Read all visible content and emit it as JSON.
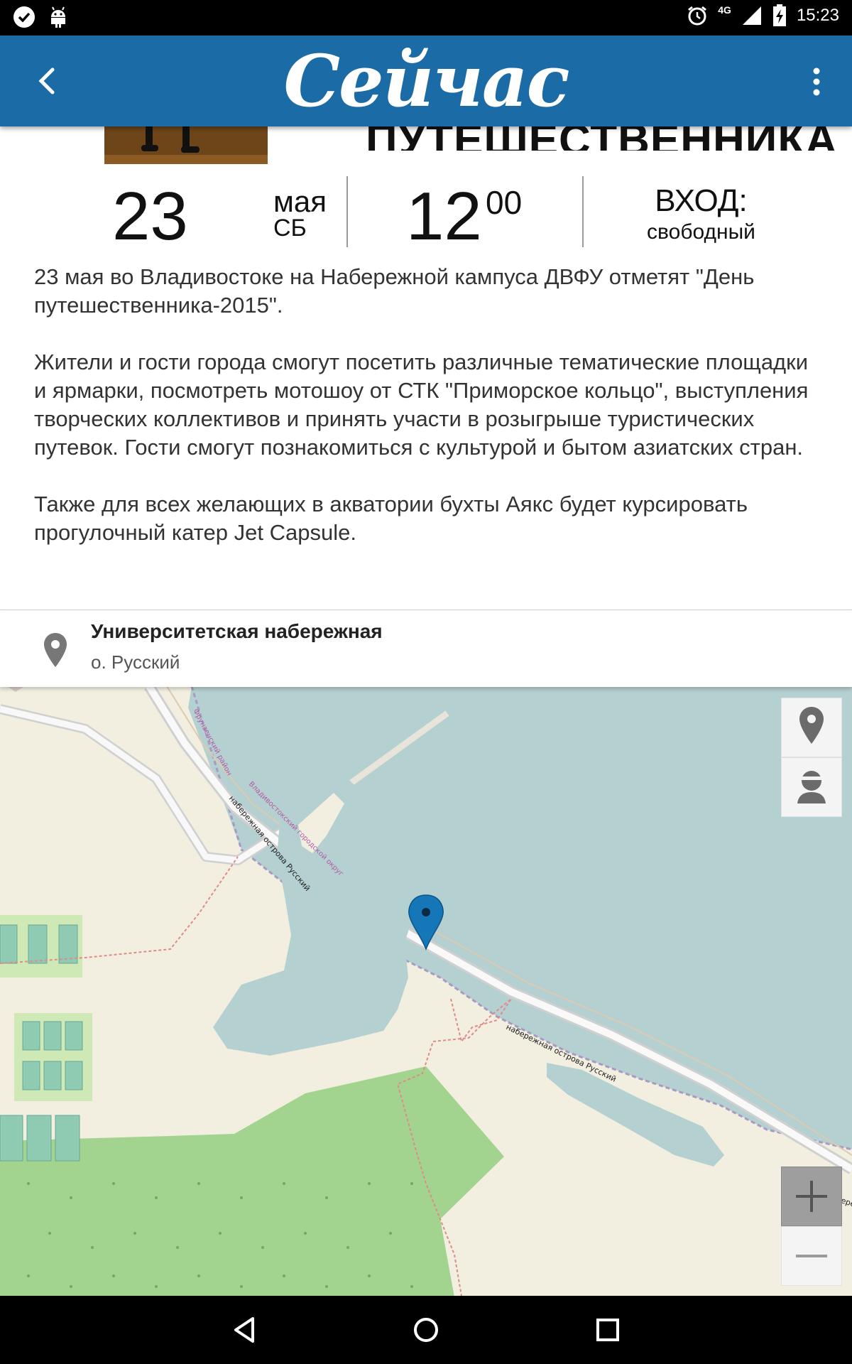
{
  "status_bar": {
    "time": "15:23",
    "network": "4G",
    "icons": [
      "check-circle-icon",
      "android-debug-icon",
      "alarm-icon",
      "signal-icon",
      "battery-charging-icon"
    ]
  },
  "app_bar": {
    "logo_text": "Сейчас",
    "color": "#1a6ba6"
  },
  "event": {
    "title_fragment": "ПУТЕШЕСТВЕННИКА",
    "day": "23",
    "month": "мая",
    "weekday": "СБ",
    "hour": "12",
    "minutes": "00",
    "entry_label": "ВХОД:",
    "entry_value": "свободный",
    "description": [
      "23 мая во Владивостоке на Набережной кампуса ДВФУ отметят \"День путешественника-2015\".",
      "Жители и гости города смогут посетить различные тематические площадки и ярмарки, посмотреть мотошоу от СТК \"Приморское кольцо\", выступления творческих коллективов и принять участи в розыгрыше туристических путевок. Гости смогут познакомиться с культурой и бытом азиатских стран.",
      "Также для всех желающих в акватории бухты Аякс будет курсировать прогулочный катер Jet Capsule."
    ]
  },
  "location": {
    "name": "Университетская набережная",
    "subtitle": "о. Русский"
  },
  "map": {
    "labels": {
      "road_1": "набережная острова Русский",
      "road_2": "набережная острова Русский",
      "district": "Фрунзенский район",
      "city_district": "Владивостокский городской округ",
      "road_edge": "Набере"
    },
    "marker_color": "#1577b8",
    "water_color": "#b5d0d0",
    "buttons": [
      "place-pin-icon",
      "my-location-icon",
      "zoom-in-icon",
      "zoom-out-icon"
    ]
  },
  "nav_bar": {
    "buttons": [
      "back-triangle-icon",
      "home-circle-icon",
      "recents-square-icon"
    ]
  }
}
